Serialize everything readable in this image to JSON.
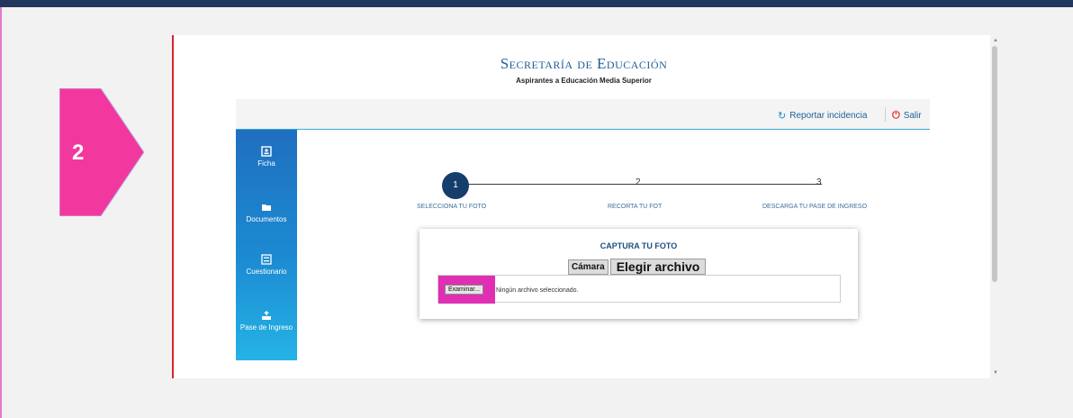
{
  "step_marker": {
    "number": "2",
    "color": "#f2389f"
  },
  "header": {
    "title": "Secretaría de Educación",
    "subtitle": "Aspirantes a Educación Media Superior"
  },
  "actions": {
    "report_label": "Reportar incidencia",
    "report_icon": "refresh-headset-icon",
    "logout_label": "Salir",
    "logout_icon": "power-icon"
  },
  "sidebar": {
    "items": [
      {
        "label": "Ficha",
        "icon": "id-card-icon"
      },
      {
        "label": "Documentos",
        "icon": "folder-icon"
      },
      {
        "label": "Cuestionario",
        "icon": "form-icon"
      },
      {
        "label": "Pase de Ingreso",
        "icon": "user-upload-icon"
      }
    ]
  },
  "stepper": {
    "steps": [
      {
        "number": "1",
        "label": "SELECCIONA TU FOTO",
        "active": true
      },
      {
        "number": "2",
        "label": "RECORTA TU FOT",
        "active": false
      },
      {
        "number": "3",
        "label": "DESCARGA TU PASE DE INGRESO",
        "active": false
      }
    ]
  },
  "capture": {
    "title": "CAPTURA TU FOTO",
    "camera_button": "Cámara",
    "choose_file_button": "Elegir archivo",
    "browse_button": "Examinar...",
    "file_status": "Ningún archivo seleccionado."
  },
  "colors": {
    "topbar": "#23375c",
    "accent": "#1f5f99",
    "highlight": "#e02fb3",
    "step_active": "#163e6c"
  }
}
